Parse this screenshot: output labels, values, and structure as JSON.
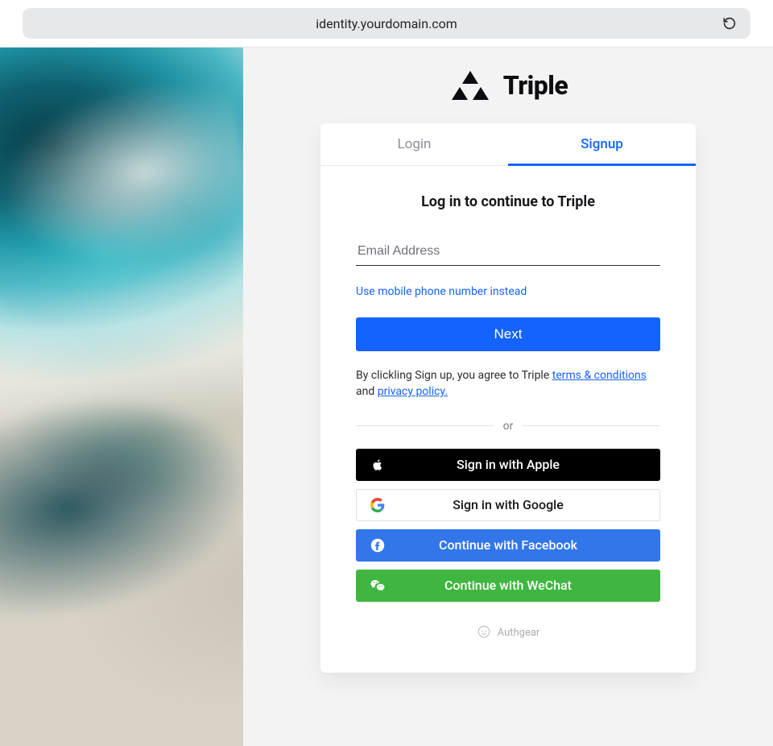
{
  "browser": {
    "url": "identity.yourdomain.com"
  },
  "brand": {
    "name": "Triple"
  },
  "tabs": {
    "login": "Login",
    "signup": "Signup",
    "active": "signup"
  },
  "form": {
    "heading": "Log in to continue to Triple",
    "email_placeholder": "Email Address",
    "email_value": "",
    "alt_method": "Use mobile phone number instead",
    "next_label": "Next"
  },
  "legal": {
    "prefix": "By clickling Sign up, you agree to Triple ",
    "terms_label": "terms & conditions",
    "middle": " and ",
    "privacy_label": "privacy policy."
  },
  "divider": {
    "label": "or"
  },
  "social": {
    "apple": "Sign in with Apple",
    "google": "Sign in with Google",
    "facebook": "Continue with Facebook",
    "wechat": "Continue with WeChat"
  },
  "footer": {
    "powered_by": "Authgear"
  },
  "colors": {
    "accent": "#1463ff",
    "apple": "#000000",
    "google_border": "#dcdde1",
    "facebook": "#3276ea",
    "wechat": "#3fb63f"
  }
}
